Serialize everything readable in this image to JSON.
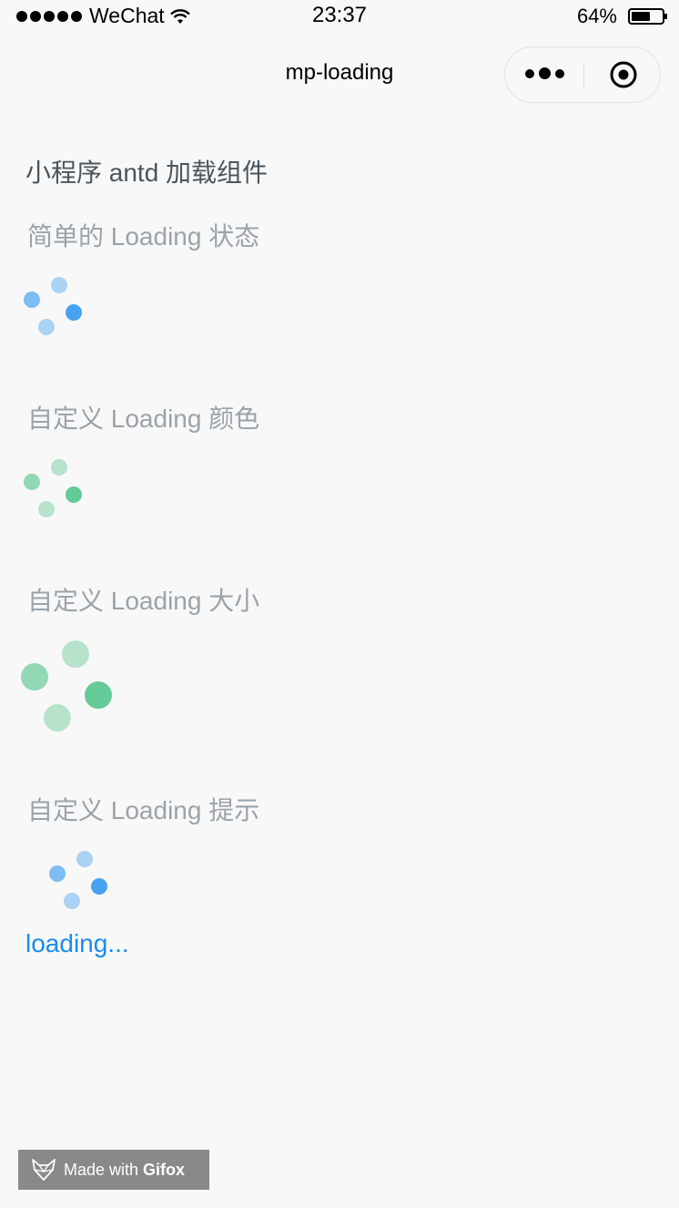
{
  "status_bar": {
    "carrier": "WeChat",
    "time": "23:37",
    "battery": "64%",
    "battery_level": 0.64
  },
  "nav": {
    "title": "mp-loading"
  },
  "page": {
    "heading": "小程序 antd 加载组件",
    "sections": [
      {
        "title": "简单的 Loading 状态"
      },
      {
        "title": "自定义 Loading 颜色"
      },
      {
        "title": "自定义 Loading 大小"
      },
      {
        "title": "自定义 Loading 提示"
      }
    ],
    "tip_text": "loading..."
  },
  "colors": {
    "blue_spinner": "#1a8cf0",
    "green_spinner": "#3ebe7e",
    "loading_text": "#1a8cf0"
  },
  "watermark": {
    "prefix": "Made with",
    "brand": "Gifox"
  }
}
